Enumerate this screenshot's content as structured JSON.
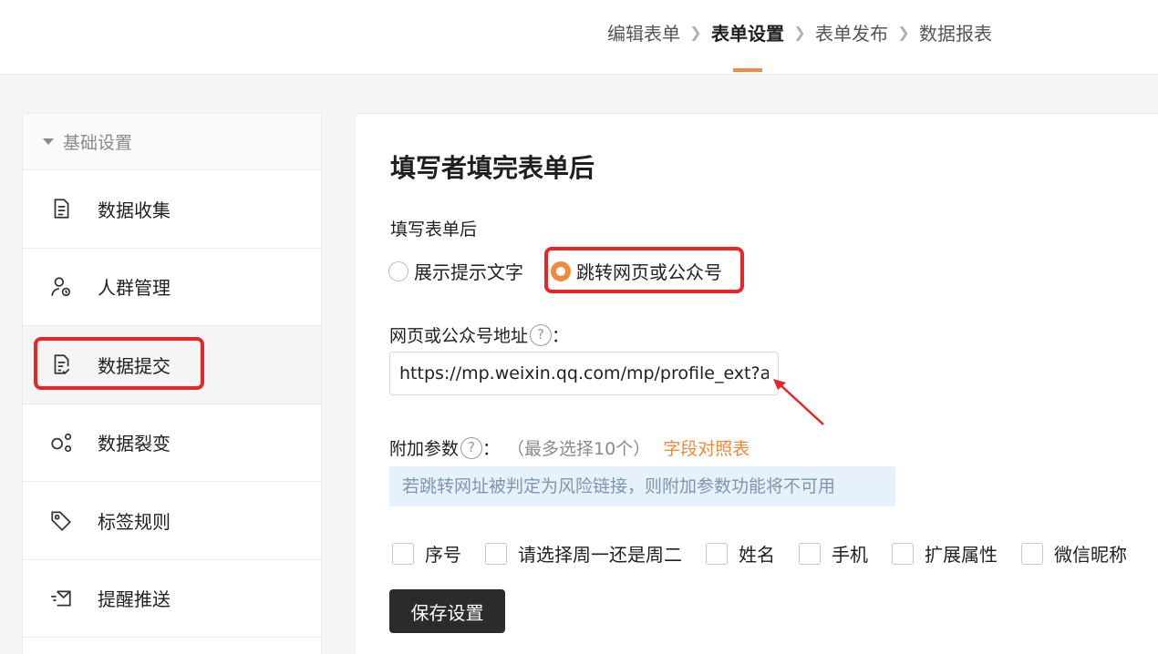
{
  "steps": [
    {
      "label": "编辑表单",
      "active": false
    },
    {
      "label": "表单设置",
      "active": true
    },
    {
      "label": "表单发布",
      "active": false
    },
    {
      "label": "数据报表",
      "active": false
    }
  ],
  "sidebar": {
    "header": "基础设置",
    "items": [
      {
        "label": "数据收集",
        "icon": "document-icon"
      },
      {
        "label": "人群管理",
        "icon": "user-settings-icon"
      },
      {
        "label": "数据提交",
        "icon": "document-check-icon",
        "active": true
      },
      {
        "label": "数据裂变",
        "icon": "fission-icon"
      },
      {
        "label": "标签规则",
        "icon": "tag-icon"
      },
      {
        "label": "提醒推送",
        "icon": "send-mail-icon"
      }
    ]
  },
  "main": {
    "title": "填写者填完表单后",
    "after_submit_label": "填写表单后",
    "radio_options": [
      {
        "label": "展示提示文字",
        "selected": false
      },
      {
        "label": "跳转网页或公众号",
        "selected": true
      }
    ],
    "url_label": "网页或公众号地址",
    "url_colon": "：",
    "url_value": "https://mp.weixin.qq.com/mp/profile_ext?action=home",
    "params_label": "附加参数",
    "params_colon": "：",
    "params_hint": "（最多选择10个）",
    "params_link": "字段对照表",
    "warning": "若跳转网址被判定为风险链接，则附加参数功能将不可用",
    "param_options": [
      "序号",
      "请选择周一还是周二",
      "姓名",
      "手机",
      "扩展属性",
      "微信昵称"
    ],
    "save_label": "保存设置",
    "help_glyph": "?"
  },
  "colors": {
    "accent": "#f08a3c",
    "highlight": "#e8262a",
    "dark_button": "#2b2b2b"
  }
}
